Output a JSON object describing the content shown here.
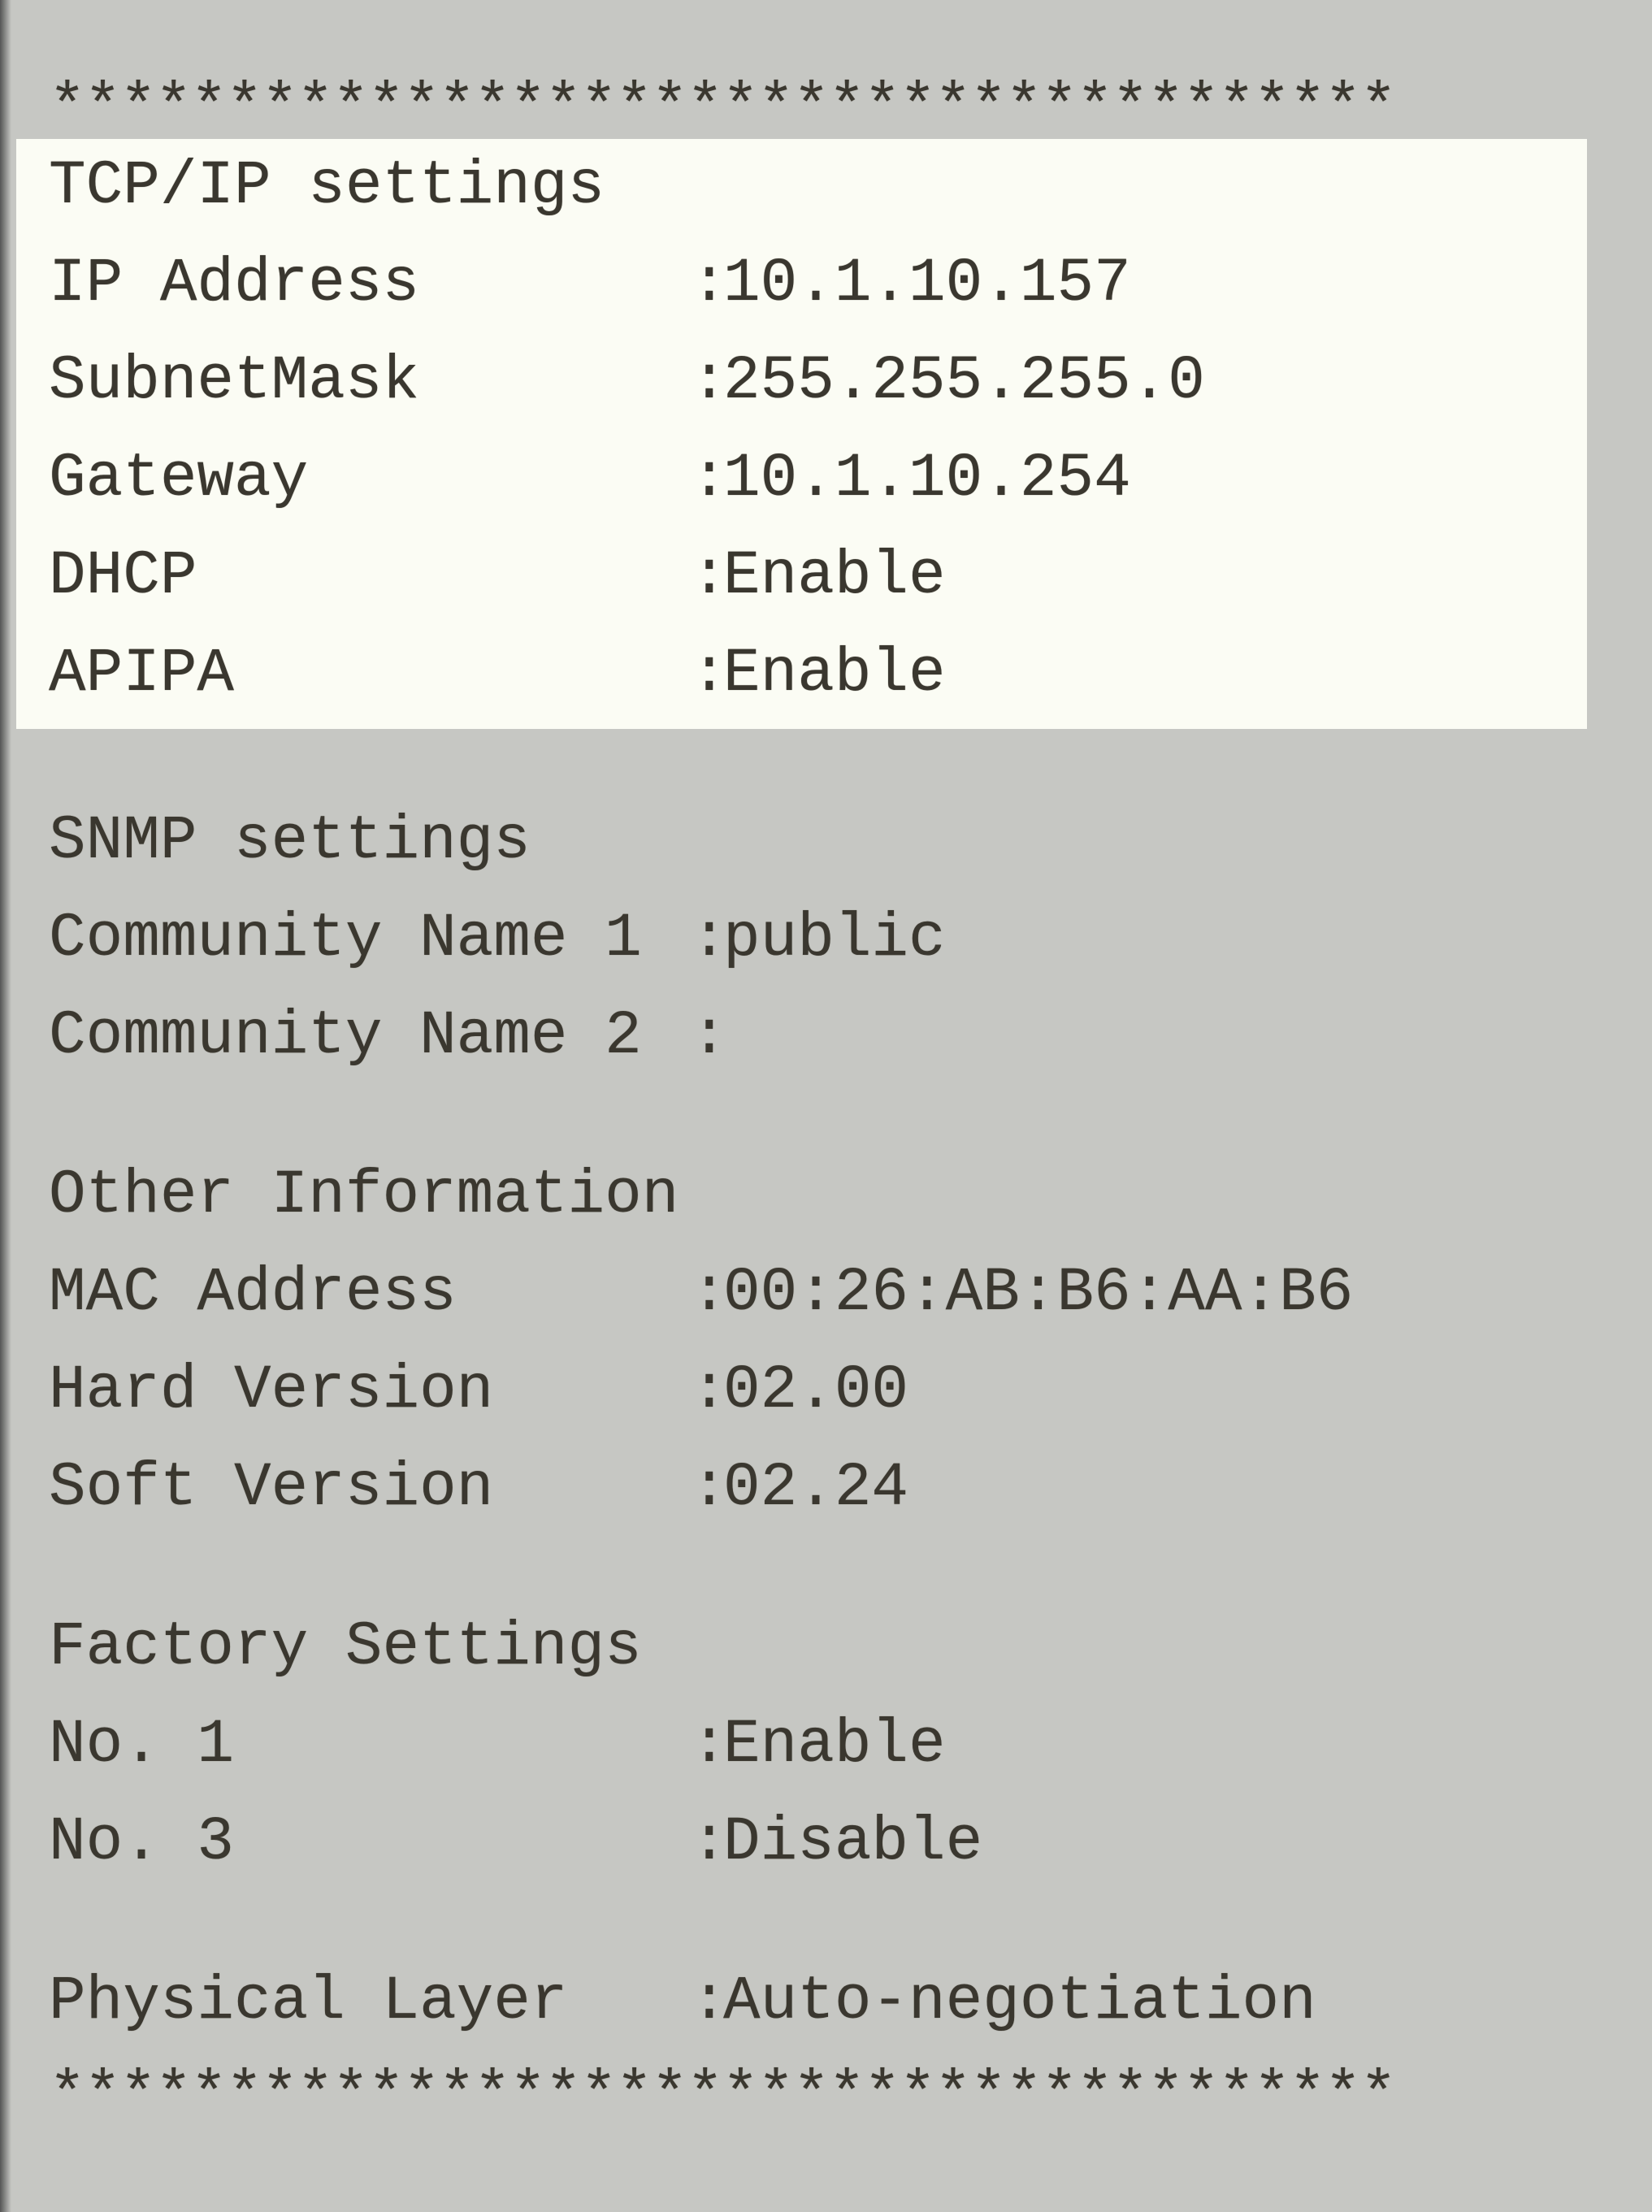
{
  "separator": "**************************************",
  "sections": {
    "tcpip": {
      "title": "TCP/IP settings",
      "rows": {
        "ip_address": {
          "label": "IP Address",
          "value": "10.1.10.157"
        },
        "subnet_mask": {
          "label": "SubnetMask",
          "value": "255.255.255.0"
        },
        "gateway": {
          "label": "Gateway",
          "value": "10.1.10.254"
        },
        "dhcp": {
          "label": "DHCP",
          "value": "Enable"
        },
        "apipa": {
          "label": "APIPA",
          "value": "Enable"
        }
      }
    },
    "snmp": {
      "title": "SNMP settings",
      "rows": {
        "community1": {
          "label": "Community Name 1",
          "value": "public"
        },
        "community2": {
          "label": "Community Name 2",
          "value": ""
        }
      }
    },
    "other": {
      "title": "Other Information",
      "rows": {
        "mac": {
          "label": "MAC Address",
          "value": "00:26:AB:B6:AA:B6"
        },
        "hard": {
          "label": "Hard Version",
          "value": "02.00"
        },
        "soft": {
          "label": "Soft Version",
          "value": "02.24"
        }
      }
    },
    "factory": {
      "title": "Factory Settings",
      "rows": {
        "no1": {
          "label": "No. 1",
          "value": "Enable"
        },
        "no3": {
          "label": "No. 3",
          "value": "Disable"
        }
      }
    },
    "physical": {
      "rows": {
        "layer": {
          "label": "Physical Layer",
          "value": "Auto-negotiation"
        }
      }
    }
  }
}
